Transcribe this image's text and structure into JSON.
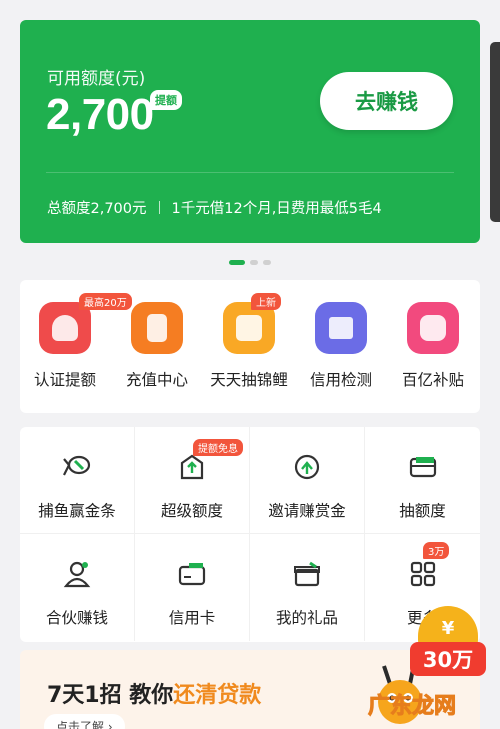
{
  "credit_card": {
    "label": "可用额度(元)",
    "amount": "2,700",
    "raise_tag": "提额",
    "earn_button": "去赚钱",
    "total_limit": "总额度2,700元",
    "promo": "1千元借12个月,日费用最低5毛4",
    "color": "#1fb04f"
  },
  "quick_actions": [
    {
      "label": "认证提额",
      "badge": "最高20万",
      "icon": "shield-icon",
      "color": "#ef4b4b"
    },
    {
      "label": "充值中心",
      "badge": "",
      "icon": "phone-icon",
      "color": "#f57d22"
    },
    {
      "label": "天天抽锦鲤",
      "badge": "上新",
      "icon": "gift-icon",
      "color": "#f9a825"
    },
    {
      "label": "信用检测",
      "badge": "",
      "icon": "report-icon",
      "color": "#6b6ce6"
    },
    {
      "label": "百亿补贴",
      "badge": "",
      "icon": "bag-icon",
      "color": "#f24a7e"
    }
  ],
  "grid_items": [
    {
      "label": "捕鱼赢金条",
      "badge": "",
      "icon": "fish-icon"
    },
    {
      "label": "超级额度",
      "badge": "提额免息",
      "icon": "arrow-up-icon"
    },
    {
      "label": "邀请赚赏金",
      "badge": "",
      "icon": "invite-icon"
    },
    {
      "label": "抽额度",
      "badge": "",
      "icon": "card-icon"
    },
    {
      "label": "合伙赚钱",
      "badge": "",
      "icon": "user-icon"
    },
    {
      "label": "信用卡",
      "badge": "",
      "icon": "credit-card-icon"
    },
    {
      "label": "我的礼品",
      "badge": "",
      "icon": "gift-box-icon"
    },
    {
      "label": "更多",
      "badge": "3万",
      "icon": "grid-icon"
    }
  ],
  "banner": {
    "title_prefix": "7天1招 教你",
    "title_highlight": "还清贷款",
    "button": "点击了解 ›"
  },
  "coupon": {
    "coin": "¥",
    "amount": "30万"
  },
  "watermark": "广东龙网"
}
